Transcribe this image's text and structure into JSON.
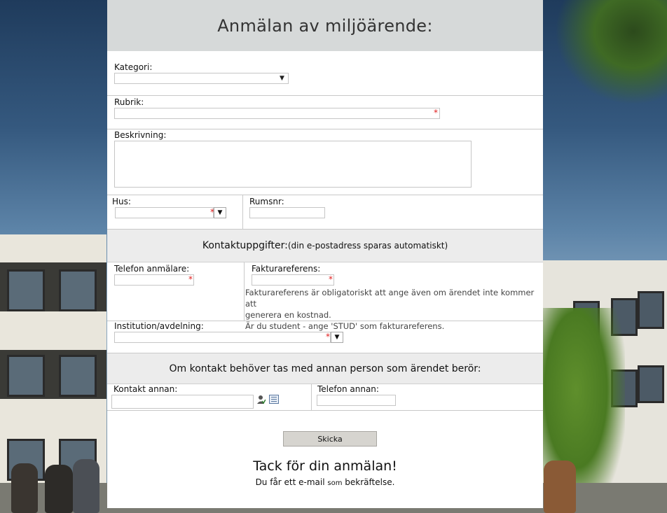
{
  "form": {
    "title": "Anmälan av miljöärende:",
    "kategori_label": "Kategori:",
    "kategori_value": "",
    "rubrik_label": "Rubrik:",
    "rubrik_value": "",
    "beskrivning_label": "Beskrivning:",
    "beskrivning_value": "",
    "hus_label": "Hus:",
    "hus_value": "",
    "rumsnr_label": "Rumsnr:",
    "rumsnr_value": "",
    "contact_section_title": "Kontaktuppgifter:",
    "contact_section_note": "(din e-postadress sparas automatiskt)",
    "telefon_label": "Telefon anmälare:",
    "telefon_value": "",
    "faktura_label": "Fakturareferens:",
    "faktura_value": "",
    "faktura_note_1": "Fakturareferens är obligatoriskt att ange även om ärendet inte kommer att",
    "faktura_note_2": "generera en kostnad.",
    "faktura_note_3": "Är du student - ange 'STUD' som fakturareferens.",
    "institution_label": "Institution/avdelning:",
    "institution_value": "",
    "other_section_title": "Om kontakt behöver tas med annan person som ärendet berör:",
    "kontakt_annan_label": "Kontakt annan:",
    "kontakt_annan_value": "",
    "telefon_annan_label": "Telefon annan:",
    "telefon_annan_value": "",
    "submit_label": "Skicka",
    "thanks_title": "Tack för din anmälan!",
    "thanks_sub_1": "Du får ett e-mail ",
    "thanks_sub_small": "som",
    "thanks_sub_2": " bekräftelse."
  },
  "icons": {
    "required": "*",
    "dropdown": "▼"
  },
  "colors": {
    "header_bg": "#d6d9d9",
    "section_bg": "#ececec",
    "required": "#e02020"
  }
}
